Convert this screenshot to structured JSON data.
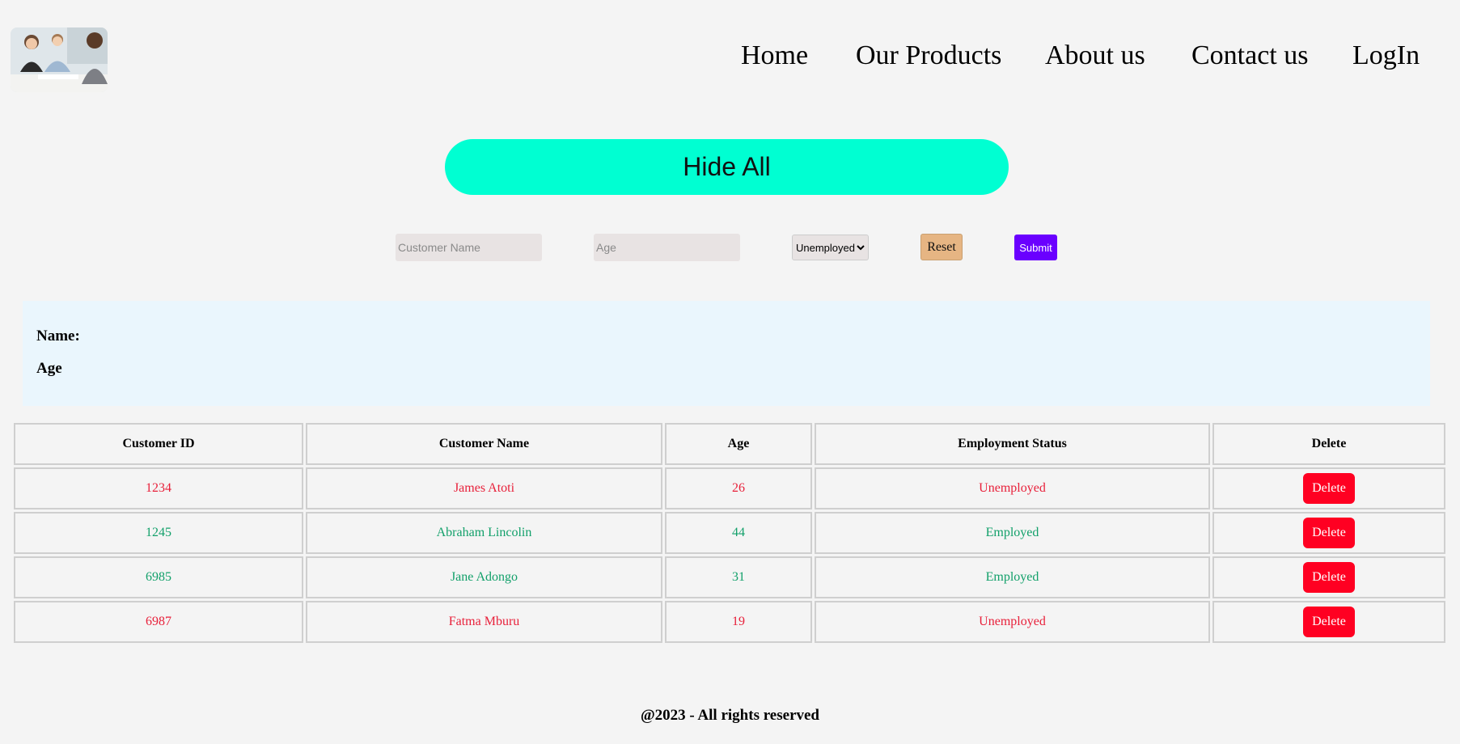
{
  "nav": {
    "items": [
      "Home",
      "Our Products",
      "About us",
      "Contact us",
      "LogIn"
    ]
  },
  "hide_all_label": "Hide All",
  "form": {
    "name_placeholder": "Customer Name",
    "age_placeholder": "Age",
    "status_selected": "Unemployed",
    "reset_label": "Reset",
    "submit_label": "Submit"
  },
  "info": {
    "name_label": "Name:",
    "age_label": "Age"
  },
  "table": {
    "headers": [
      "Customer ID",
      "Customer Name",
      "Age",
      "Employment Status",
      "Delete"
    ],
    "rows": [
      {
        "id": "1234",
        "name": "James Atoti",
        "age": "26",
        "status": "Unemployed",
        "delete": "Delete"
      },
      {
        "id": "1245",
        "name": "Abraham Lincolin",
        "age": "44",
        "status": "Employed",
        "delete": "Delete"
      },
      {
        "id": "6985",
        "name": "Jane Adongo",
        "age": "31",
        "status": "Employed",
        "delete": "Delete"
      },
      {
        "id": "6987",
        "name": "Fatma Mburu",
        "age": "19",
        "status": "Unemployed",
        "delete": "Delete"
      }
    ]
  },
  "footer": "@2023 - All rights reserved",
  "colors": {
    "hide_all_bg": "#00ffd2",
    "employed": "#12a06a",
    "unemployed": "#e8203a",
    "delete_bg": "#ff0022",
    "submit_bg": "#6a00ff",
    "reset_bg": "#e6b583"
  }
}
